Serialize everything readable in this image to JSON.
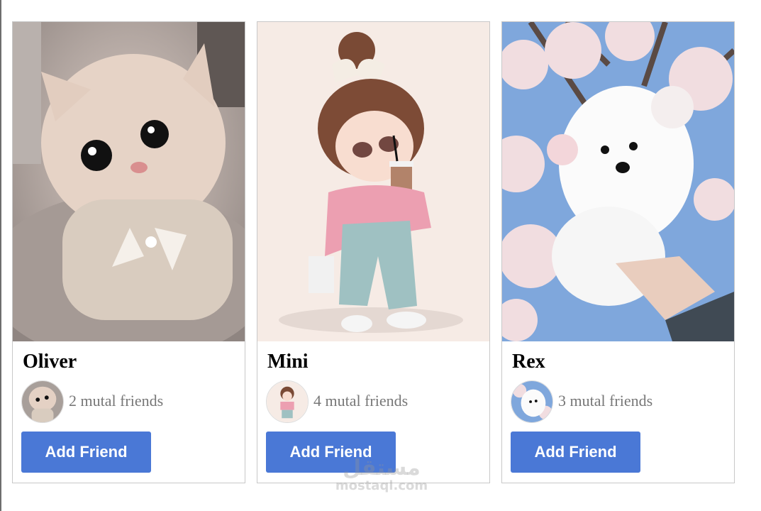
{
  "cards": [
    {
      "name": "Oliver",
      "mutual": "2 mutal friends",
      "button": "Add Friend",
      "image": "kitten-in-knit-sweater"
    },
    {
      "name": "Mini",
      "mutual": "4 mutal friends",
      "button": "Add Friend",
      "image": "cartoon-girl-with-drink"
    },
    {
      "name": "Rex",
      "mutual": "3 mutal friends",
      "button": "Add Friend",
      "image": "white-puppy-cherry-blossoms"
    }
  ],
  "watermark": {
    "arabic": "مستقل",
    "latin": "mostaql.com"
  },
  "colors": {
    "button_bg": "#4a78d6",
    "button_text": "#ffffff",
    "muted_text": "#777777",
    "card_border": "#c8c8c8"
  }
}
